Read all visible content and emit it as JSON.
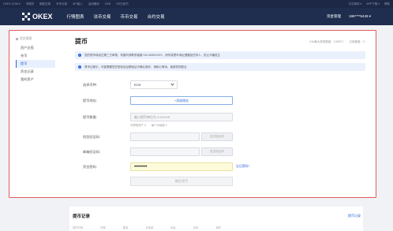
{
  "topbar": {
    "items": [
      "OKEX.COM ▾",
      "币期货",
      "期权交易",
      "币币交易",
      "API接入",
      "活动期间",
      "OKB",
      "OK白皮书"
    ],
    "right": [
      "中文简体 ▾",
      "APP下载 ▾",
      "帮助"
    ]
  },
  "navbar": {
    "brand": "OKEX",
    "nav": [
      "行情图表",
      "法币交易",
      "币币交易",
      "合约交易"
    ],
    "asset": "资金管理",
    "user": "186****6449 ▾"
  },
  "sidebar": {
    "head": "资金管理",
    "items": [
      "资产总揽",
      "充币",
      "提币",
      "资金记录",
      "我的资产"
    ],
    "active_index": 2
  },
  "main": {
    "title": "提币",
    "limits": [
      "24h最大提现额度：100BTC",
      "已用额度：0"
    ],
    "notices": [
      "您的提币将经过第三方审核，有疑问请联系客服 010-5069XXXX，请勿将提币地址透露给任何人，防止诈骗发生",
      "提币过程中，可能需要您在短信及谷歌验证中确认操作，请耐心等待，谢谢您的配合"
    ],
    "form": {
      "currency_label": "选择币种:",
      "currency_value": "EOS",
      "address_label": "提币地址:",
      "address_placeholder": "+添加地址",
      "amount_label": "提币数量:",
      "amount_placeholder": "最小提币单位为 0.01EOS",
      "amount_hints": [
        "可提现资产 0",
        "每个手续费 0"
      ],
      "sms_label": "短信验证码:",
      "sms_button": "发送验证码",
      "email_label": "邮箱验证码:",
      "email_button": "发送验证码",
      "pwd_label": "资金密码:",
      "pwd_value": "•••••••••",
      "forgot": "忘记密码?",
      "submit": "确定提币"
    }
  },
  "records": {
    "title": "提币记录",
    "link": "提币记录",
    "columns": [
      "提币时间",
      "币种",
      "数量",
      "手续费",
      "地址",
      "状态",
      "操作"
    ]
  }
}
